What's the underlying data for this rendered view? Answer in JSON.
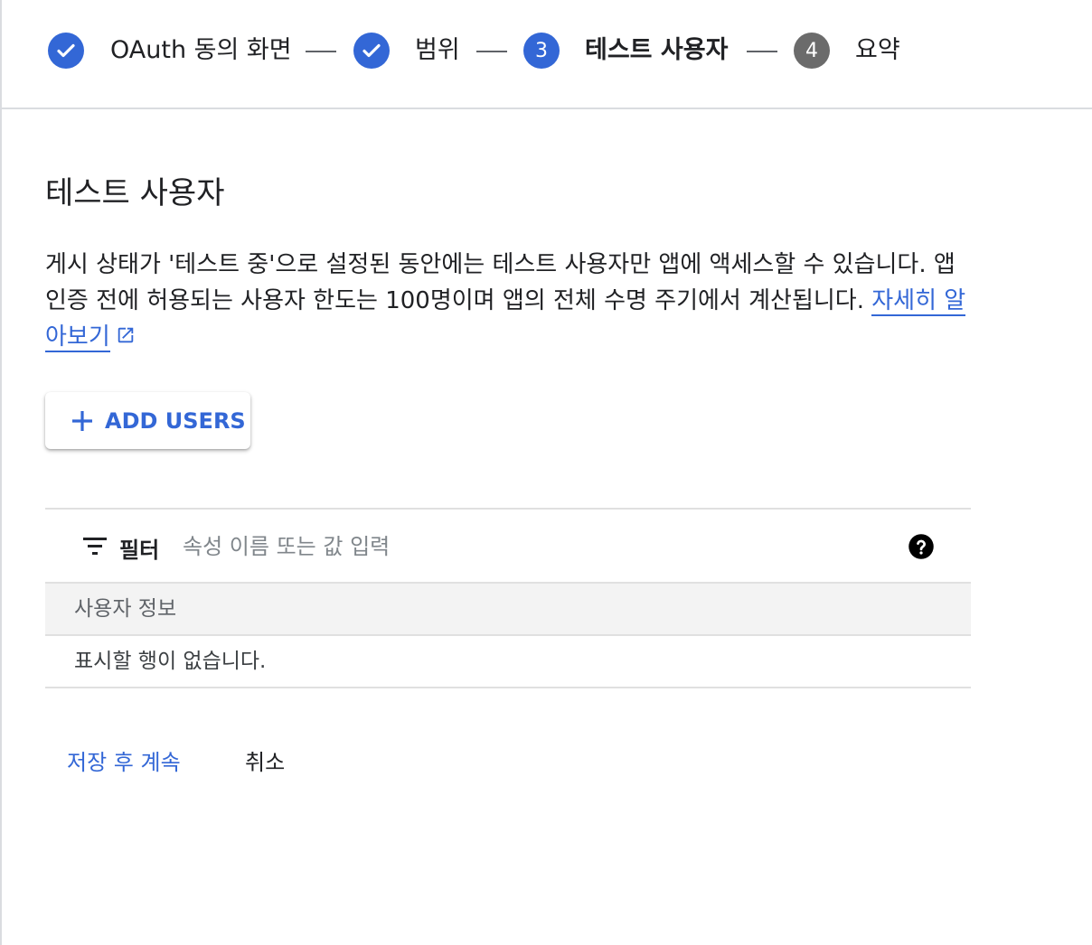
{
  "stepper": {
    "steps": [
      {
        "label": "OAuth 동의 화면",
        "status": "done"
      },
      {
        "label": "범위",
        "status": "done"
      },
      {
        "number": "3",
        "label": "테스트 사용자",
        "status": "active"
      },
      {
        "number": "4",
        "label": "요약",
        "status": "todo"
      }
    ]
  },
  "main": {
    "title": "테스트 사용자",
    "description": "게시 상태가 '테스트 중'으로 설정된 동안에는 테스트 사용자만 앱에 액세스할 수 있습니다. 앱 인증 전에 허용되는 사용자 한도는 100명이며 앱의 전체 수명 주기에서 계산됩니다.",
    "learn_more": "자세히 알아보기",
    "add_users_label": "ADD USERS"
  },
  "table": {
    "filter_label": "필터",
    "filter_placeholder": "속성 이름 또는 값 입력",
    "column_header": "사용자 정보",
    "empty_message": "표시할 행이 없습니다."
  },
  "actions": {
    "save_label": "저장 후 계속",
    "cancel_label": "취소"
  },
  "colors": {
    "accent": "#3367d6",
    "pending_step": "#6b6b6b",
    "divider": "#dadce0"
  }
}
